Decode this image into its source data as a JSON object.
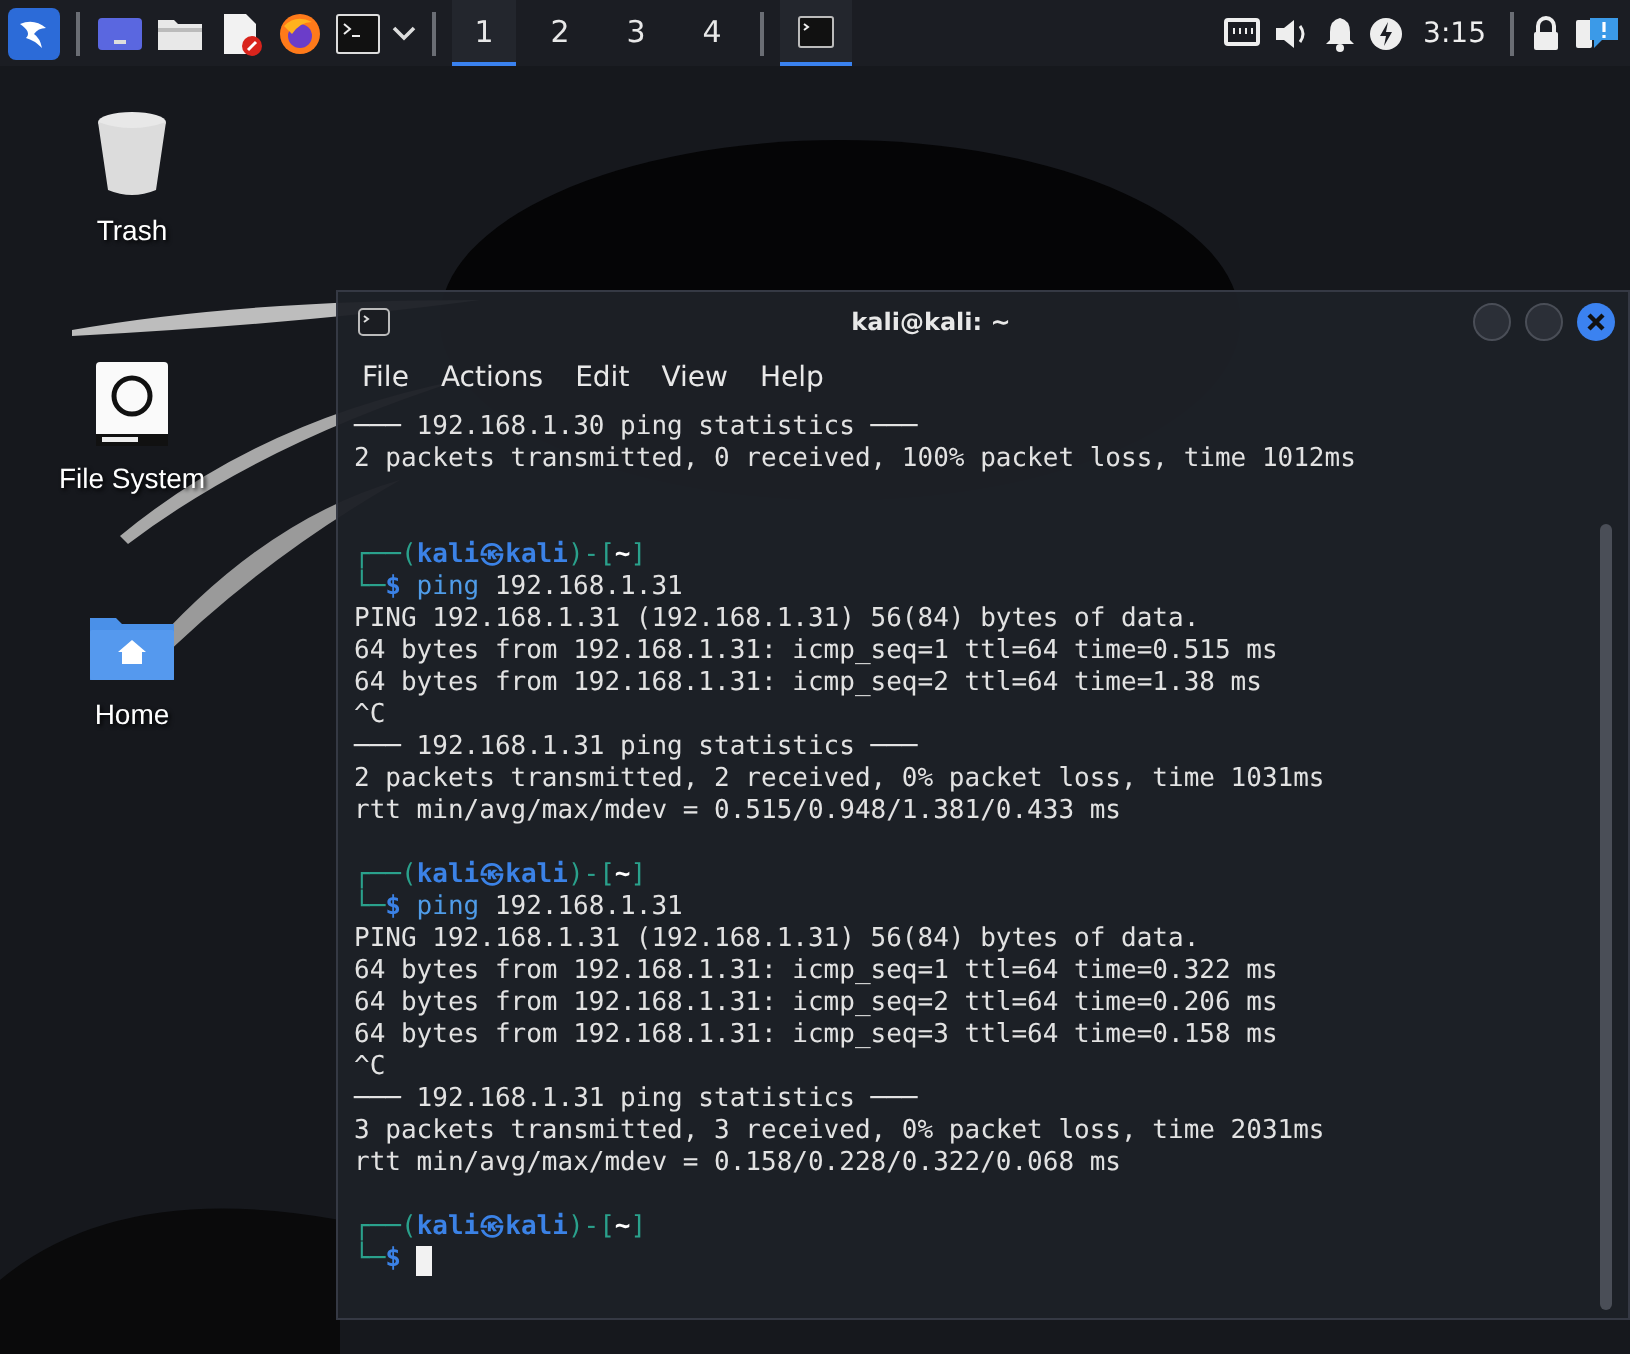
{
  "taskbar": {
    "workspaces": [
      {
        "label": "1",
        "selected": true
      },
      {
        "label": "2",
        "selected": false
      },
      {
        "label": "3",
        "selected": false
      },
      {
        "label": "4",
        "selected": false
      }
    ],
    "tasks": [
      {
        "selected": true
      }
    ],
    "clock": "3:15"
  },
  "desktop_icons": [
    {
      "label": "Trash",
      "kind": "trash"
    },
    {
      "label": "File System",
      "kind": "drive"
    },
    {
      "label": "Home",
      "kind": "home"
    }
  ],
  "terminal": {
    "title": "kali@kali: ~",
    "menu": [
      "File",
      "Actions",
      "Edit",
      "View",
      "Help"
    ],
    "lines": [
      {
        "kind": "output",
        "text": "─── 192.168.1.30 ping statistics ───"
      },
      {
        "kind": "output",
        "text": "2 packets transmitted, 0 received, 100% packet loss, time 1012ms"
      },
      {
        "kind": "blank"
      },
      {
        "kind": "blank"
      },
      {
        "kind": "prompt",
        "segments": [
          {
            "kind": "frame",
            "text": "┌──("
          },
          {
            "kind": "user",
            "text": "kali㉿kali"
          },
          {
            "kind": "frame",
            "text": ")-["
          },
          {
            "kind": "path",
            "text": "~"
          },
          {
            "kind": "frame",
            "text": "]"
          }
        ]
      },
      {
        "kind": "prompt",
        "segments": [
          {
            "kind": "frame",
            "text": "└─"
          },
          {
            "kind": "user",
            "text": "$"
          },
          {
            "kind": "command",
            "text": "ping"
          },
          {
            "kind": "arg",
            "text": "192.168.1.31"
          }
        ]
      },
      {
        "kind": "output",
        "text": "PING 192.168.1.31 (192.168.1.31) 56(84) bytes of data."
      },
      {
        "kind": "output",
        "text": "64 bytes from 192.168.1.31: icmp_seq=1 ttl=64 time=0.515 ms"
      },
      {
        "kind": "output",
        "text": "64 bytes from 192.168.1.31: icmp_seq=2 ttl=64 time=1.38 ms"
      },
      {
        "kind": "output",
        "text": "^C"
      },
      {
        "kind": "output",
        "text": "─── 192.168.1.31 ping statistics ───"
      },
      {
        "kind": "output",
        "text": "2 packets transmitted, 2 received, 0% packet loss, time 1031ms"
      },
      {
        "kind": "output",
        "text": "rtt min/avg/max/mdev = 0.515/0.948/1.381/0.433 ms"
      },
      {
        "kind": "blank"
      },
      {
        "kind": "prompt",
        "segments": [
          {
            "kind": "frame",
            "text": "┌──("
          },
          {
            "kind": "user",
            "text": "kali㉿kali"
          },
          {
            "kind": "frame",
            "text": ")-["
          },
          {
            "kind": "path",
            "text": "~"
          },
          {
            "kind": "frame",
            "text": "]"
          }
        ]
      },
      {
        "kind": "prompt",
        "segments": [
          {
            "kind": "frame",
            "text": "└─"
          },
          {
            "kind": "user",
            "text": "$"
          },
          {
            "kind": "command",
            "text": "ping"
          },
          {
            "kind": "arg",
            "text": "192.168.1.31"
          }
        ]
      },
      {
        "kind": "output",
        "text": "PING 192.168.1.31 (192.168.1.31) 56(84) bytes of data."
      },
      {
        "kind": "output",
        "text": "64 bytes from 192.168.1.31: icmp_seq=1 ttl=64 time=0.322 ms"
      },
      {
        "kind": "output",
        "text": "64 bytes from 192.168.1.31: icmp_seq=2 ttl=64 time=0.206 ms"
      },
      {
        "kind": "output",
        "text": "64 bytes from 192.168.1.31: icmp_seq=3 ttl=64 time=0.158 ms"
      },
      {
        "kind": "output",
        "text": "^C"
      },
      {
        "kind": "output",
        "text": "─── 192.168.1.31 ping statistics ───"
      },
      {
        "kind": "output",
        "text": "3 packets transmitted, 3 received, 0% packet loss, time 2031ms"
      },
      {
        "kind": "output",
        "text": "rtt min/avg/max/mdev = 0.158/0.228/0.322/0.068 ms"
      },
      {
        "kind": "blank"
      },
      {
        "kind": "prompt",
        "segments": [
          {
            "kind": "frame",
            "text": "┌──("
          },
          {
            "kind": "user",
            "text": "kali㉿kali"
          },
          {
            "kind": "frame",
            "text": ")-["
          },
          {
            "kind": "path",
            "text": "~"
          },
          {
            "kind": "frame",
            "text": "]"
          }
        ]
      },
      {
        "kind": "input",
        "segments": [
          {
            "kind": "frame",
            "text": "└─"
          },
          {
            "kind": "user",
            "text": "$"
          }
        ]
      }
    ]
  }
}
